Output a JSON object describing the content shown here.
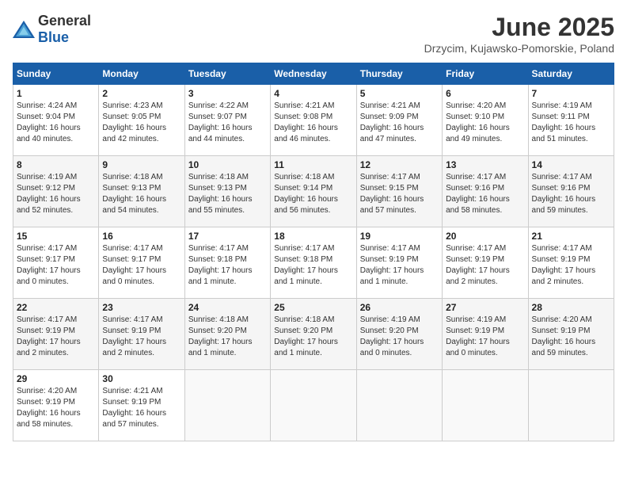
{
  "header": {
    "logo_general": "General",
    "logo_blue": "Blue",
    "month_title": "June 2025",
    "subtitle": "Drzycim, Kujawsko-Pomorskie, Poland"
  },
  "days_of_week": [
    "Sunday",
    "Monday",
    "Tuesday",
    "Wednesday",
    "Thursday",
    "Friday",
    "Saturday"
  ],
  "weeks": [
    [
      {
        "day": "1",
        "sunrise": "Sunrise: 4:24 AM",
        "sunset": "Sunset: 9:04 PM",
        "daylight": "Daylight: 16 hours and 40 minutes."
      },
      {
        "day": "2",
        "sunrise": "Sunrise: 4:23 AM",
        "sunset": "Sunset: 9:05 PM",
        "daylight": "Daylight: 16 hours and 42 minutes."
      },
      {
        "day": "3",
        "sunrise": "Sunrise: 4:22 AM",
        "sunset": "Sunset: 9:07 PM",
        "daylight": "Daylight: 16 hours and 44 minutes."
      },
      {
        "day": "4",
        "sunrise": "Sunrise: 4:21 AM",
        "sunset": "Sunset: 9:08 PM",
        "daylight": "Daylight: 16 hours and 46 minutes."
      },
      {
        "day": "5",
        "sunrise": "Sunrise: 4:21 AM",
        "sunset": "Sunset: 9:09 PM",
        "daylight": "Daylight: 16 hours and 47 minutes."
      },
      {
        "day": "6",
        "sunrise": "Sunrise: 4:20 AM",
        "sunset": "Sunset: 9:10 PM",
        "daylight": "Daylight: 16 hours and 49 minutes."
      },
      {
        "day": "7",
        "sunrise": "Sunrise: 4:19 AM",
        "sunset": "Sunset: 9:11 PM",
        "daylight": "Daylight: 16 hours and 51 minutes."
      }
    ],
    [
      {
        "day": "8",
        "sunrise": "Sunrise: 4:19 AM",
        "sunset": "Sunset: 9:12 PM",
        "daylight": "Daylight: 16 hours and 52 minutes."
      },
      {
        "day": "9",
        "sunrise": "Sunrise: 4:18 AM",
        "sunset": "Sunset: 9:13 PM",
        "daylight": "Daylight: 16 hours and 54 minutes."
      },
      {
        "day": "10",
        "sunrise": "Sunrise: 4:18 AM",
        "sunset": "Sunset: 9:13 PM",
        "daylight": "Daylight: 16 hours and 55 minutes."
      },
      {
        "day": "11",
        "sunrise": "Sunrise: 4:18 AM",
        "sunset": "Sunset: 9:14 PM",
        "daylight": "Daylight: 16 hours and 56 minutes."
      },
      {
        "day": "12",
        "sunrise": "Sunrise: 4:17 AM",
        "sunset": "Sunset: 9:15 PM",
        "daylight": "Daylight: 16 hours and 57 minutes."
      },
      {
        "day": "13",
        "sunrise": "Sunrise: 4:17 AM",
        "sunset": "Sunset: 9:16 PM",
        "daylight": "Daylight: 16 hours and 58 minutes."
      },
      {
        "day": "14",
        "sunrise": "Sunrise: 4:17 AM",
        "sunset": "Sunset: 9:16 PM",
        "daylight": "Daylight: 16 hours and 59 minutes."
      }
    ],
    [
      {
        "day": "15",
        "sunrise": "Sunrise: 4:17 AM",
        "sunset": "Sunset: 9:17 PM",
        "daylight": "Daylight: 17 hours and 0 minutes."
      },
      {
        "day": "16",
        "sunrise": "Sunrise: 4:17 AM",
        "sunset": "Sunset: 9:17 PM",
        "daylight": "Daylight: 17 hours and 0 minutes."
      },
      {
        "day": "17",
        "sunrise": "Sunrise: 4:17 AM",
        "sunset": "Sunset: 9:18 PM",
        "daylight": "Daylight: 17 hours and 1 minute."
      },
      {
        "day": "18",
        "sunrise": "Sunrise: 4:17 AM",
        "sunset": "Sunset: 9:18 PM",
        "daylight": "Daylight: 17 hours and 1 minute."
      },
      {
        "day": "19",
        "sunrise": "Sunrise: 4:17 AM",
        "sunset": "Sunset: 9:19 PM",
        "daylight": "Daylight: 17 hours and 1 minute."
      },
      {
        "day": "20",
        "sunrise": "Sunrise: 4:17 AM",
        "sunset": "Sunset: 9:19 PM",
        "daylight": "Daylight: 17 hours and 2 minutes."
      },
      {
        "day": "21",
        "sunrise": "Sunrise: 4:17 AM",
        "sunset": "Sunset: 9:19 PM",
        "daylight": "Daylight: 17 hours and 2 minutes."
      }
    ],
    [
      {
        "day": "22",
        "sunrise": "Sunrise: 4:17 AM",
        "sunset": "Sunset: 9:19 PM",
        "daylight": "Daylight: 17 hours and 2 minutes."
      },
      {
        "day": "23",
        "sunrise": "Sunrise: 4:17 AM",
        "sunset": "Sunset: 9:19 PM",
        "daylight": "Daylight: 17 hours and 2 minutes."
      },
      {
        "day": "24",
        "sunrise": "Sunrise: 4:18 AM",
        "sunset": "Sunset: 9:20 PM",
        "daylight": "Daylight: 17 hours and 1 minute."
      },
      {
        "day": "25",
        "sunrise": "Sunrise: 4:18 AM",
        "sunset": "Sunset: 9:20 PM",
        "daylight": "Daylight: 17 hours and 1 minute."
      },
      {
        "day": "26",
        "sunrise": "Sunrise: 4:19 AM",
        "sunset": "Sunset: 9:20 PM",
        "daylight": "Daylight: 17 hours and 0 minutes."
      },
      {
        "day": "27",
        "sunrise": "Sunrise: 4:19 AM",
        "sunset": "Sunset: 9:19 PM",
        "daylight": "Daylight: 17 hours and 0 minutes."
      },
      {
        "day": "28",
        "sunrise": "Sunrise: 4:20 AM",
        "sunset": "Sunset: 9:19 PM",
        "daylight": "Daylight: 16 hours and 59 minutes."
      }
    ],
    [
      {
        "day": "29",
        "sunrise": "Sunrise: 4:20 AM",
        "sunset": "Sunset: 9:19 PM",
        "daylight": "Daylight: 16 hours and 58 minutes."
      },
      {
        "day": "30",
        "sunrise": "Sunrise: 4:21 AM",
        "sunset": "Sunset: 9:19 PM",
        "daylight": "Daylight: 16 hours and 57 minutes."
      },
      null,
      null,
      null,
      null,
      null
    ]
  ]
}
